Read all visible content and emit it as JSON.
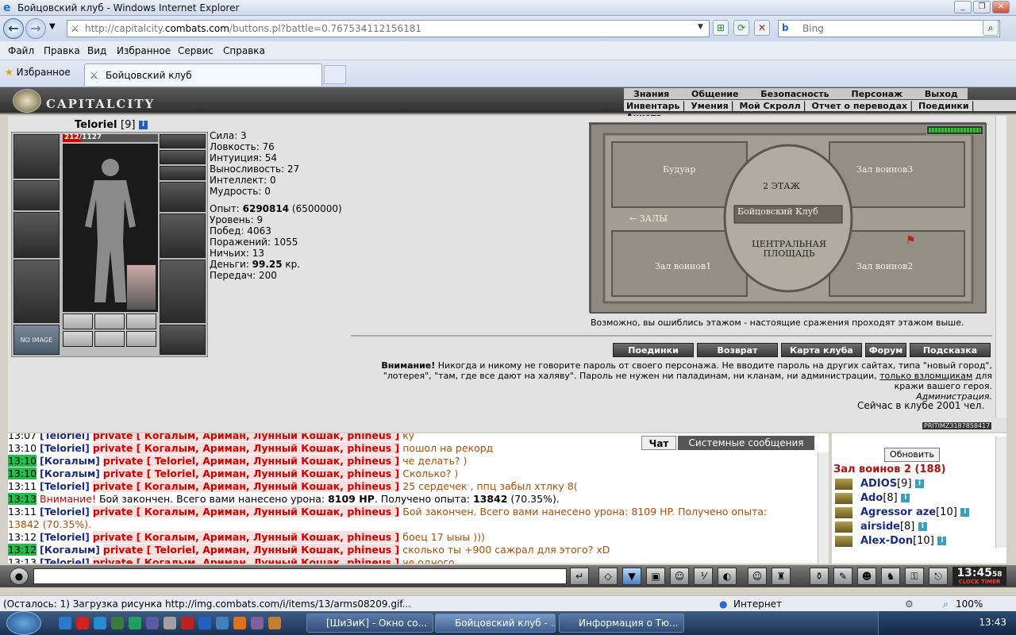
{
  "window": {
    "title": "Бойцовский клуб - Windows Internet Explorer"
  },
  "browser": {
    "url_prefix": "http://capitalcity.",
    "url_domain": "combats.com",
    "url_path": "/buttons.pl?battle=0.767534112156181",
    "search_placeholder": "Bing",
    "menu": [
      "Файл",
      "Правка",
      "Вид",
      "Избранное",
      "Сервис",
      "Справка"
    ],
    "favorites_label": "Избранное",
    "tab_label": "Бойцовский клуб"
  },
  "game": {
    "logo": "CAPITALCITY",
    "menu_top": [
      "Знания",
      "Общение",
      "Безопасность",
      "Персонаж",
      "Выход"
    ],
    "menu_bottom": [
      "Инвентарь",
      "Умения",
      "Мой Скролл",
      "Отчет о переводах",
      "Поединки",
      "Анкета"
    ],
    "character": {
      "name": "Teloriel",
      "level": "[9]",
      "hp_text": "212/1127",
      "hp_fraction": 0.188,
      "no_image": "NO IMAGE"
    },
    "stats": {
      "strength": "Сила: 3",
      "agility": "Ловкость: 76",
      "intuition": "Интуиция: 54",
      "endurance": "Выносливость: 27",
      "intellect": "Интеллект: 0",
      "wisdom": "Мудрость: 0",
      "exp_label": "Опыт: ",
      "exp_value": "6290814",
      "exp_next": " (6500000)",
      "level": "Уровень: 9",
      "wins": "Побед: 4063",
      "losses": "Поражений: 1055",
      "draws": "Ничьих: 13",
      "money_label": "Деньги: ",
      "money_value": "99.25",
      "money_unit": " кр.",
      "transfers": "Передач: 200"
    },
    "map": {
      "boudoir": "Будуар",
      "hall3": "Зал воинов3",
      "floor2": "2 ЭТАЖ",
      "club": "Бойцовский Клуб",
      "halls": "← ЗАЛЫ",
      "central": "ЦЕНТРАЛЬНАЯ ПЛОЩАДЬ",
      "hall1": "Зал воинов1",
      "hall2": "Зал воинов2"
    },
    "map_note": "Возможно, вы ошиблись этажом - настоящие сражения проходят этажом выше.",
    "buttons": [
      "Поединки",
      "Возврат",
      "Карта клуба",
      "Форум",
      "Подсказка"
    ],
    "warning_bold": "Внимание!",
    "warning_text": " Никогда и никому не говорите пароль от своего персонажа. Не вводите пароль на других сайтах, типа \"новый город\", \"лотерея\", \"там, где все дают на халяву\". Пароль не нужен ни паладинам, ни кланам, ни администрации, ",
    "warning_link": "только взломщикам",
    "warning_tail": " для кражи вашего героя.",
    "admin": "Администрация.",
    "online": "Сейчас в клубе 2001 чел.",
    "pritim": "PRITIMZ3187858417"
  },
  "chat": {
    "tabs": [
      "Чат",
      "Системные сообщения"
    ],
    "lines": [
      {
        "time": "13:07",
        "hl": false,
        "nick": "[Teloriel]",
        "priv": "private [ Когалым, Ариман, Лунный Кошак, phineus ]",
        "msg": "ку"
      },
      {
        "time": "13:10",
        "hl": false,
        "nick": "[Teloriel]",
        "priv": "private [ Когалым, Ариман, Лунный Кошак, phineus ]",
        "msg": "пошол на рекорд"
      },
      {
        "time": "13:10",
        "hl": true,
        "nick": "[Когалым]",
        "priv": "private [ Teloriel, Ариман, Лунный Кошак, phineus ]",
        "msg": "че делать? )"
      },
      {
        "time": "13:10",
        "hl": true,
        "nick": "[Когалым]",
        "priv": "private [ Teloriel, Ариман, Лунный Кошак, phineus ]",
        "msg": "Сколько? )"
      },
      {
        "time": "13:11",
        "hl": false,
        "nick": "[Teloriel]",
        "priv": "private [ Когалым, Ариман, Лунный Кошак, phineus ]",
        "msg": "25 сердечек , ппц забыл хтлку 8("
      },
      {
        "time": "13:12",
        "hl": false,
        "nick": "[Teloriel]",
        "priv": "private [ Когалым, Ариман, Лунный Кошак, phineus ]",
        "msg": "боец 17 ыыы )))"
      },
      {
        "time": "13:12",
        "hl": true,
        "nick": "[Когалым]",
        "priv": "private [ Teloriel, Ариман, Лунный Кошак, phineus ]",
        "msg": "сколько ты +900 сажрал для этого? xD"
      },
      {
        "time": "13:13",
        "hl": false,
        "nick": "[Teloriel]",
        "priv": "private [ Когалым, Ариман, Лунный Кошак, phineus ]",
        "msg": "че одного"
      }
    ],
    "sys1": {
      "time": "13:13",
      "warn": "Внимание!",
      "text": " Бой закончен. Всего вами нанесено урона: ",
      "dmg": "8109 HP",
      "text2": ". Получено опыта: ",
      "exp": "13842",
      "pct": " (70.35%)."
    },
    "sys2": {
      "time": "13:11",
      "nick": "[Teloriel]",
      "priv": "private [ Когалым, Ариман, Лунный Кошак, phineus ]",
      "msg": "Бой закончен. Всего вами нанесено урона: 8109 HP. Получено опыта:",
      "msg2": "13842 (70.35%)."
    }
  },
  "userlist": {
    "refresh": "Обновить",
    "room": "Зал воинов 2 (188)",
    "users": [
      {
        "name": "ADIOS",
        "level": "[9]"
      },
      {
        "name": "Ado",
        "level": "[8]"
      },
      {
        "name": "Agressor aze",
        "level": "[10]"
      },
      {
        "name": "airside",
        "level": "[8]"
      },
      {
        "name": "Alex-Don",
        "level": "[10]"
      }
    ]
  },
  "clock": {
    "time": "13:45",
    "sec": "58",
    "labels": "CLOCK TIMER"
  },
  "statusbar": {
    "text": "(Осталось: 1) Загрузка рисунка http://img.combats.com/i/items/13/arms08209.gif...",
    "zone": "Интернет",
    "zoom": "100%"
  },
  "taskbar": {
    "items": [
      "[ШиЗиК] - Окно со...",
      "Бойцовский клуб - ...",
      "Информация о Тю..."
    ],
    "time": "13:43"
  }
}
